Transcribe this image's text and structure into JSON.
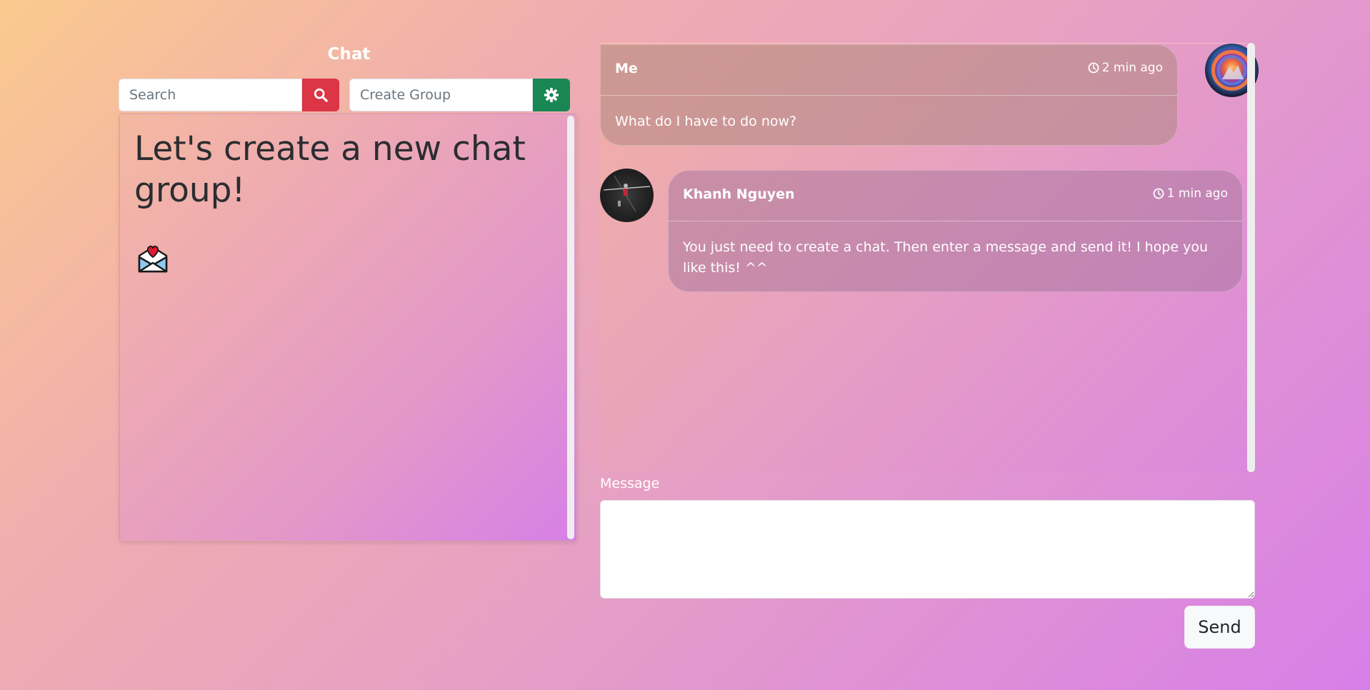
{
  "sidebar": {
    "title": "Chat",
    "search": {
      "placeholder": "Search",
      "value": ""
    },
    "create_group": {
      "placeholder": "Create Group",
      "value": ""
    },
    "empty_state": {
      "heading": "Let's create a new chat group!",
      "icon": "love-letter-icon"
    }
  },
  "conversation": {
    "messages": [
      {
        "sender": "Me",
        "time": "2 min ago",
        "text": "What do I have to do now?",
        "avatar": "galaxy-avatar"
      },
      {
        "sender": "Khanh Nguyen",
        "time": "1 min ago",
        "text": "You just need to create a chat. Then enter a message and send it! I hope you like this! ^^",
        "avatar": "dark-photo-avatar"
      }
    ],
    "composer": {
      "label": "Message",
      "value": "",
      "send_label": "Send"
    }
  },
  "colors": {
    "search_button": "#dc3545",
    "settings_button": "#198754",
    "send_button": "#f8f9fa"
  }
}
